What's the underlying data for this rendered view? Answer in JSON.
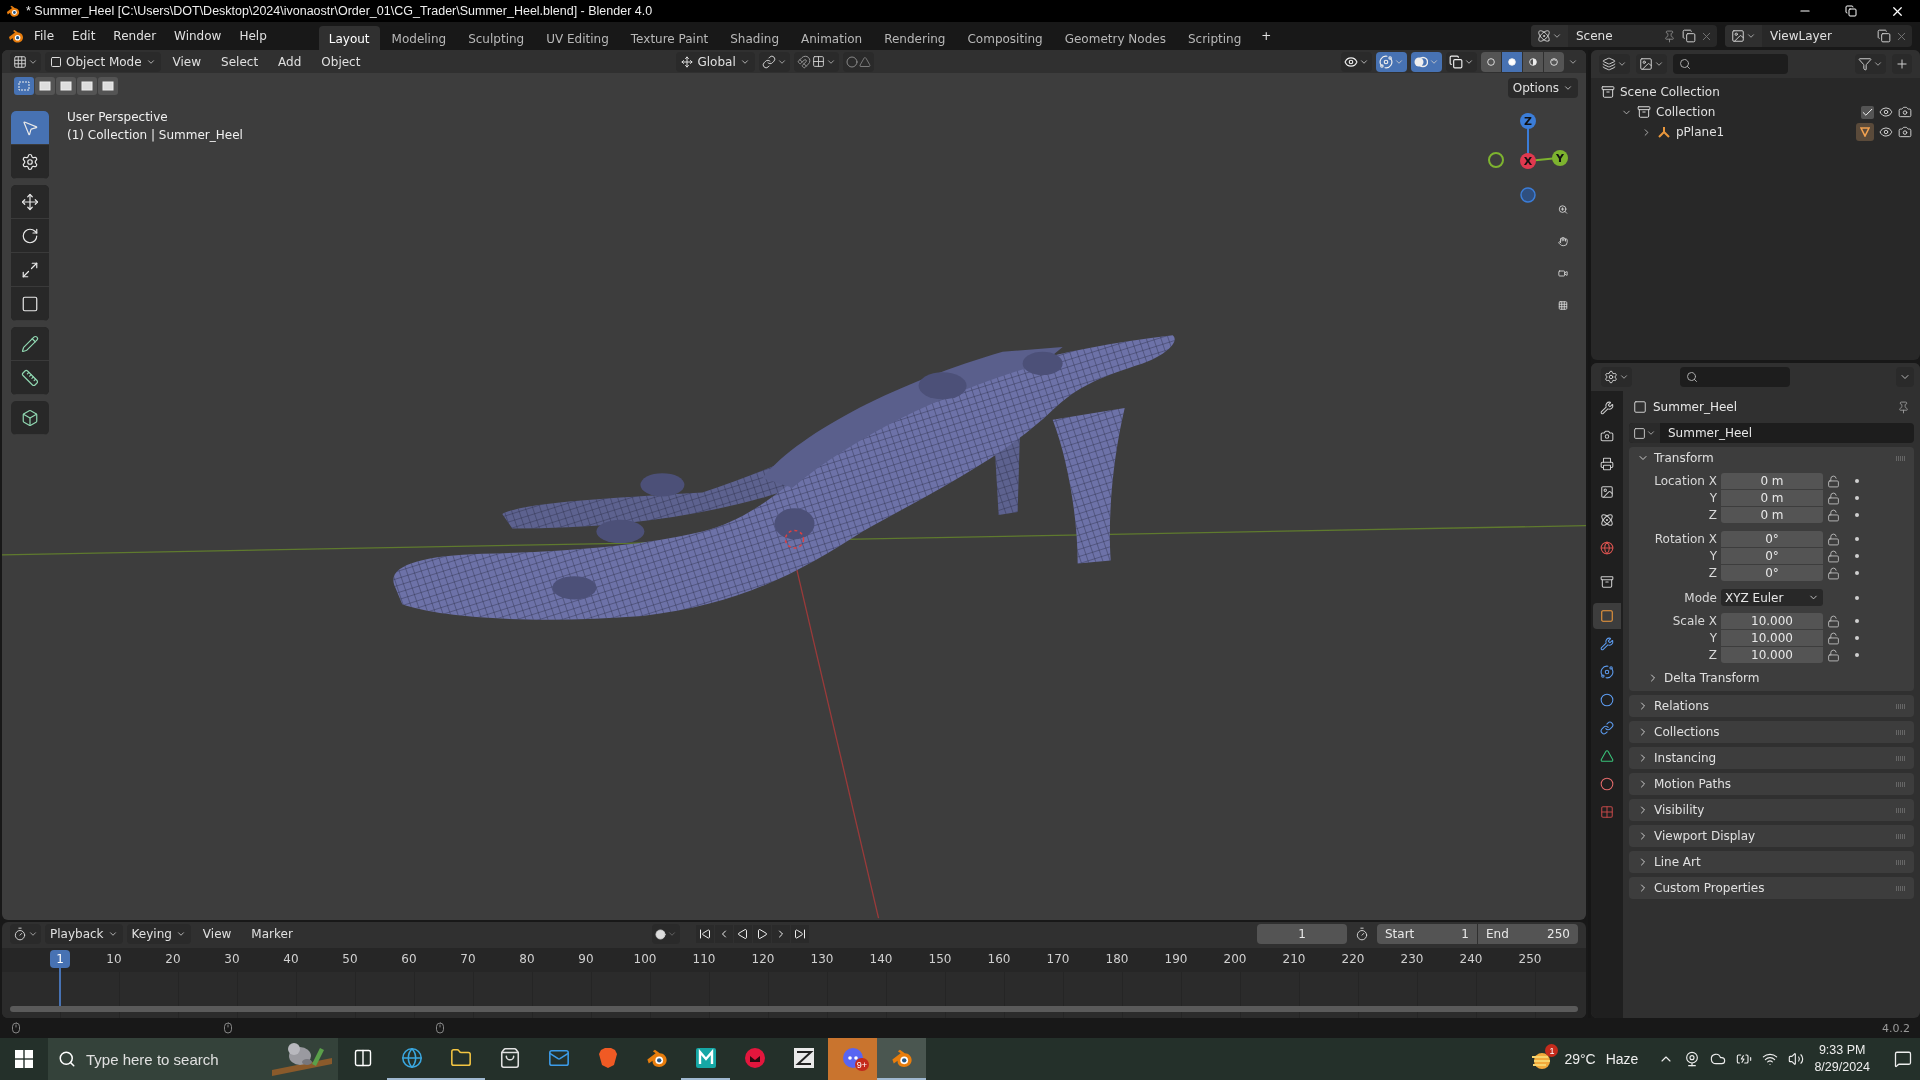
{
  "title_bar": {
    "title": "* Summer_Heel [C:\\Users\\DOT\\Desktop\\2024\\ivonaostr\\Order_01\\CG_Trader\\Summer_Heel.blend] - Blender 4.0"
  },
  "menus": [
    "File",
    "Edit",
    "Render",
    "Window",
    "Help"
  ],
  "workspaces": [
    {
      "label": "Layout",
      "selected": true
    },
    {
      "label": "Modeling",
      "selected": false
    },
    {
      "label": "Sculpting",
      "selected": false
    },
    {
      "label": "UV Editing",
      "selected": false
    },
    {
      "label": "Texture Paint",
      "selected": false
    },
    {
      "label": "Shading",
      "selected": false
    },
    {
      "label": "Animation",
      "selected": false
    },
    {
      "label": "Rendering",
      "selected": false
    },
    {
      "label": "Compositing",
      "selected": false
    },
    {
      "label": "Geometry Nodes",
      "selected": false
    },
    {
      "label": "Scripting",
      "selected": false
    }
  ],
  "add_workspace": "+",
  "scene": "Scene",
  "view_layer": "ViewLayer",
  "viewport": {
    "mode": "Object Mode",
    "menus": [
      "View",
      "Select",
      "Add",
      "Object"
    ],
    "orientation": "Global",
    "options": "Options",
    "select_modes": [
      {
        "selected": true
      },
      {
        "selected": false
      },
      {
        "selected": false
      },
      {
        "selected": false
      },
      {
        "selected": false
      }
    ],
    "header_toggles": [
      {
        "selected": false
      },
      {
        "selected": true
      },
      {
        "selected": true
      },
      {
        "selected": false
      }
    ],
    "shading": [
      {
        "selected": false
      },
      {
        "selected": true
      },
      {
        "selected": false
      },
      {
        "selected": false
      }
    ],
    "tools": [
      {
        "selected": true
      },
      {
        "selected": false
      },
      {
        "selected": false
      },
      {
        "selected": false
      },
      {
        "selected": false
      },
      {
        "selected": false
      },
      {
        "selected": false
      },
      {
        "selected": false
      },
      {
        "selected": false
      }
    ],
    "overlay_lines": [
      "User Perspective",
      "(1) Collection | Summer_Heel"
    ],
    "gizmo_axes": [
      "Z",
      "X",
      "Y"
    ]
  },
  "outliner": {
    "items": [
      {
        "label": "Scene Collection",
        "children": [
          {
            "label": "Collection",
            "expanded": true,
            "checked": true,
            "children": [
              {
                "label": "pPlane1",
                "expanded": false
              }
            ]
          }
        ]
      }
    ]
  },
  "properties": {
    "object_name": "Summer_Heel",
    "data_name": "Summer_Heel",
    "tabs": [
      {
        "selected": false
      },
      {
        "selected": false
      },
      {
        "selected": false
      },
      {
        "selected": false
      },
      {
        "selected": false
      },
      {
        "selected": false
      },
      {
        "selected": false
      },
      {
        "selected": true
      },
      {
        "selected": false
      },
      {
        "selected": false
      },
      {
        "selected": false
      },
      {
        "selected": false
      },
      {
        "selected": false
      },
      {
        "selected": false
      },
      {
        "selected": false
      }
    ],
    "transform": {
      "title": "Transform",
      "expanded": true,
      "groups": [
        {
          "rows": [
            {
              "kind": "field",
              "label": "Location X",
              "value": "0 m"
            },
            {
              "kind": "field",
              "label": "Y",
              "value": "0 m"
            },
            {
              "kind": "field",
              "label": "Z",
              "value": "0 m"
            }
          ]
        },
        {
          "rows": [
            {
              "kind": "field",
              "label": "Rotation X",
              "value": "0°"
            },
            {
              "kind": "field",
              "label": "Y",
              "value": "0°"
            },
            {
              "kind": "field",
              "label": "Z",
              "value": "0°"
            }
          ]
        },
        {
          "rows": [
            {
              "kind": "dropdown",
              "label": "Mode",
              "value": "XYZ Euler"
            }
          ]
        },
        {
          "rows": [
            {
              "kind": "field",
              "label": "Scale X",
              "value": "10.000"
            },
            {
              "kind": "field",
              "label": "Y",
              "value": "10.000"
            },
            {
              "kind": "field",
              "label": "Z",
              "value": "10.000"
            }
          ]
        }
      ],
      "subpanel": {
        "label": "Delta Transform",
        "expanded": false
      }
    },
    "panels": [
      {
        "label": "Relations",
        "expanded": false
      },
      {
        "label": "Collections",
        "expanded": false
      },
      {
        "label": "Instancing",
        "expanded": false
      },
      {
        "label": "Motion Paths",
        "expanded": false
      },
      {
        "label": "Visibility",
        "expanded": false
      },
      {
        "label": "Viewport Display",
        "expanded": false
      },
      {
        "label": "Line Art",
        "expanded": false
      },
      {
        "label": "Custom Properties",
        "expanded": false
      }
    ]
  },
  "timeline": {
    "menus": [
      "Playback",
      "Keying",
      "View",
      "Marker"
    ],
    "current_frame": "1",
    "start_label": "Start",
    "start": "1",
    "end_label": "End",
    "end": "250",
    "playhead_label": "1",
    "ticks": [
      "10",
      "20",
      "30",
      "40",
      "50",
      "60",
      "70",
      "80",
      "90",
      "100",
      "110",
      "120",
      "130",
      "140",
      "150",
      "160",
      "170",
      "180",
      "190",
      "200",
      "210",
      "220",
      "230",
      "240",
      "250"
    ]
  },
  "version": "4.0.2",
  "taskbar": {
    "search_placeholder": "Type here to search",
    "apps": [
      {
        "running": false,
        "selected": false
      },
      {
        "running": true,
        "selected": false
      },
      {
        "running": true,
        "selected": false
      },
      {
        "running": false,
        "selected": false
      },
      {
        "running": false,
        "selected": false
      },
      {
        "running": false,
        "selected": false
      },
      {
        "running": false,
        "selected": false
      },
      {
        "running": true,
        "selected": false
      },
      {
        "running": false,
        "selected": false
      },
      {
        "running": false,
        "selected": false
      },
      {
        "running": false,
        "selected": false,
        "hovered": true
      },
      {
        "running": true,
        "selected": true
      }
    ],
    "chat_badge": "9+",
    "weather_badge": "1",
    "temperature": "29°C",
    "condition": "Haze",
    "time": "9:33 PM",
    "date": "8/29/2024"
  }
}
